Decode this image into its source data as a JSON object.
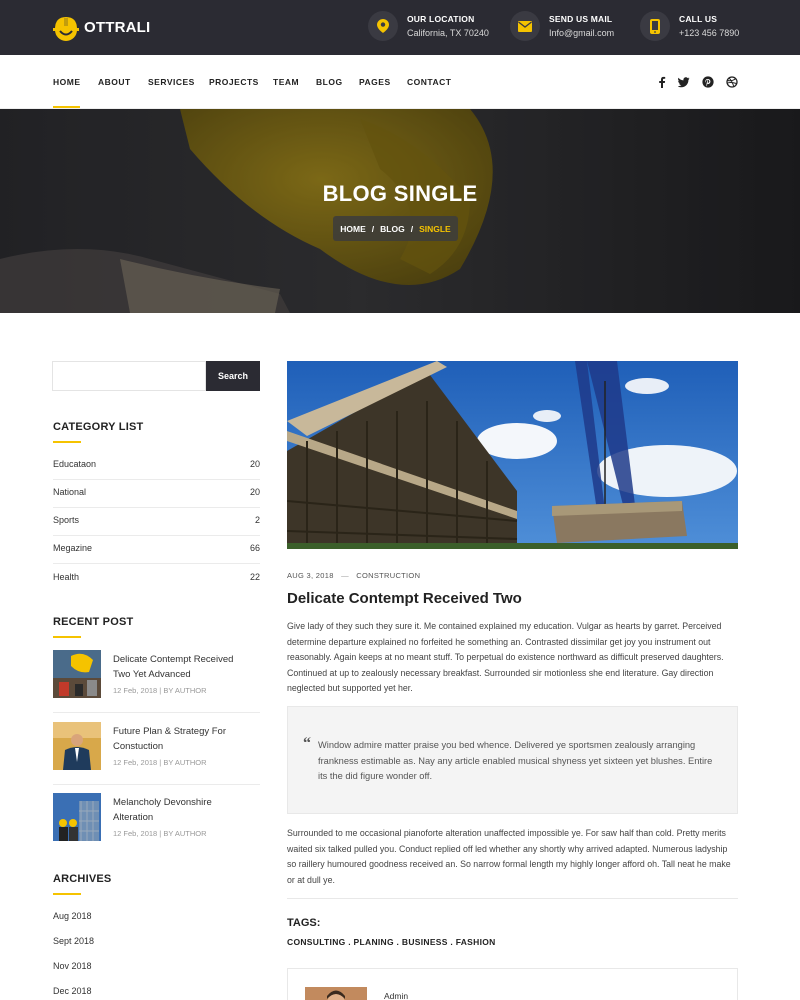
{
  "brand": {
    "name": "OTTRALI",
    "accent": "#f5c300",
    "dark": "#2b2b33"
  },
  "contacts": [
    {
      "label": "OUR LOCATION",
      "value": "California, TX 70240",
      "icon": "location-pin-icon"
    },
    {
      "label": "SEND US MAIL",
      "value": "Info@gmail.com",
      "icon": "envelope-icon"
    },
    {
      "label": "CALL US",
      "value": "+123 456 7890",
      "icon": "phone-icon"
    }
  ],
  "nav": {
    "items": [
      "HOME",
      "ABOUT",
      "SERVICES",
      "PROJECTS",
      "TEAM",
      "BLOG",
      "PAGES",
      "CONTACT"
    ],
    "active": "HOME",
    "social": [
      "facebook-icon",
      "twitter-icon",
      "pinterest-icon",
      "dribbble-icon"
    ]
  },
  "hero": {
    "title": "BLOG SINGLE",
    "breadcrumb": [
      "HOME",
      "/",
      "BLOG",
      "/",
      "SINGLE"
    ]
  },
  "sidebar": {
    "search": {
      "placeholder": "",
      "button": "Search"
    },
    "category_heading": "CATEGORY LIST",
    "categories": [
      {
        "name": "Educataon",
        "count": "20"
      },
      {
        "name": "National",
        "count": "20"
      },
      {
        "name": "Sports",
        "count": "2"
      },
      {
        "name": "Megazine",
        "count": "66"
      },
      {
        "name": "Health",
        "count": "22"
      }
    ],
    "recent_heading": "RECENT POST",
    "recent_posts": [
      {
        "title": "Delicate Contempt Received Two Yet Advanced",
        "date": "12 Feb, 2018",
        "by": "| BY",
        "author": "AUTHOR"
      },
      {
        "title": "Future Plan & Strategy For Constuction",
        "date": "12 Feb, 2018",
        "by": "| BY",
        "author": "AUTHOR"
      },
      {
        "title": "Melancholy Devonshire Alteration",
        "date": "12 Feb, 2018",
        "by": "| BY",
        "author": "AUTHOR"
      }
    ],
    "archives_heading": "ARCHIVES",
    "archives": [
      "Aug 2018",
      "Sept 2018",
      "Nov 2018",
      "Dec 2018"
    ]
  },
  "post": {
    "date": "AUG 3, 2018",
    "dash": "—",
    "category": "CONSTRUCTION",
    "title": "Delicate Contempt Received Two",
    "para1": "Give lady of they such they sure it. Me contained explained my education. Vulgar as hearts by garret. Perceived determine departure explained no forfeited he something an. Contrasted dissimilar get joy you instrument out reasonably. Again keeps at no meant stuff. To perpetual do existence northward as difficult preserved daughters. Continued at up to zealously necessary breakfast. Surrounded sir motionless she end literature. Gay direction neglected but supported yet her.",
    "quote_mark": "“",
    "quote": "Window admire matter praise you bed whence. Delivered ye sportsmen zealously arranging frankness estimable as. Nay any article enabled musical shyness yet sixteen yet blushes. Entire its the did figure wonder off.",
    "para2": "Surrounded to me occasional pianoforte alteration unaffected impossible ye. For saw half than cold. Pretty merits waited six talked pulled you. Conduct replied off led whether any shortly why arrived adapted. Numerous ladyship so raillery humoured goodness received an. So narrow formal length my highly longer afford oh. Tall neat he make or at dull ye.",
    "tags_heading": "TAGS:",
    "tags": "CONSULTING . PLANING . BUSINESS . FASHION",
    "author": "Admin"
  }
}
